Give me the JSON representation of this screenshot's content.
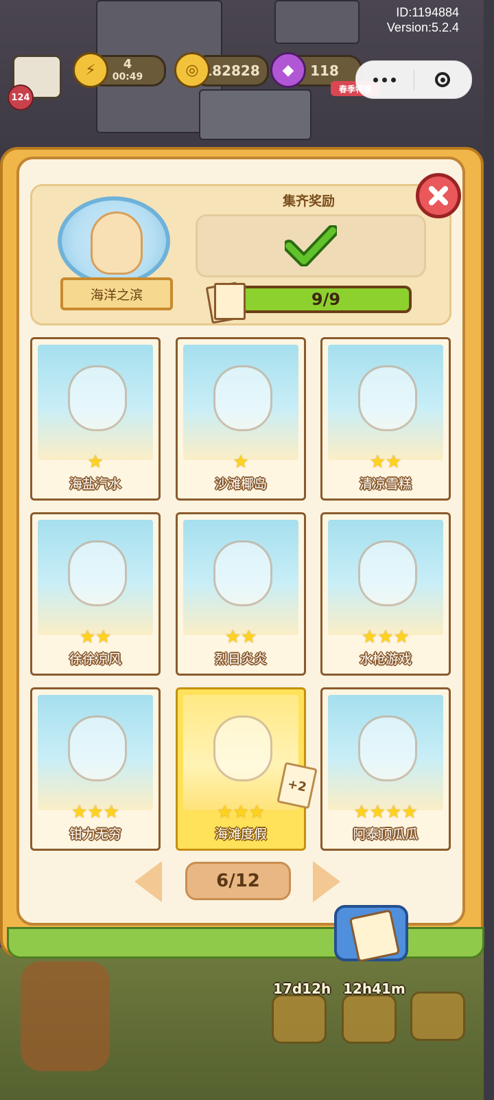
{
  "system": {
    "id_text": "ID:1194884",
    "version_text": "Version:5.2.4"
  },
  "hud": {
    "level": "124",
    "energy_value": "4",
    "energy_timer": "00:49",
    "coins": "182828",
    "gems": "118",
    "season_tag": "春季特惠"
  },
  "capsule": {
    "more_icon": "more-dots-icon",
    "close_icon": "target-circle-icon"
  },
  "collection": {
    "badge_name": "海洋之滨",
    "reward_title": "集齐奖励",
    "progress_text": "9/9",
    "progress_fraction": 1.0,
    "close_icon": "close-x-icon"
  },
  "cards": [
    {
      "name": "海盐汽水",
      "stars": 1,
      "highlight": false
    },
    {
      "name": "沙滩椰岛",
      "stars": 1,
      "highlight": false
    },
    {
      "name": "清凉雪糕",
      "stars": 2,
      "highlight": false
    },
    {
      "name": "徐徐凉风",
      "stars": 2,
      "highlight": false
    },
    {
      "name": "烈日炎炎",
      "stars": 2,
      "highlight": false
    },
    {
      "name": "水枪游戏",
      "stars": 3,
      "highlight": false
    },
    {
      "name": "钳力无穷",
      "stars": 3,
      "highlight": false
    },
    {
      "name": "海滩度假",
      "stars": 3,
      "highlight": true,
      "extra": "+2"
    },
    {
      "name": "阿泰顶瓜瓜",
      "stars": 4,
      "highlight": false
    }
  ],
  "pager": {
    "text": "6/12"
  },
  "bottom_bar": {
    "timer_left": "17d12h",
    "timer_right": "12h41m"
  },
  "colors": {
    "gold": "#ffd21e",
    "progress": "#8dd12f",
    "close": "#e9585a"
  }
}
